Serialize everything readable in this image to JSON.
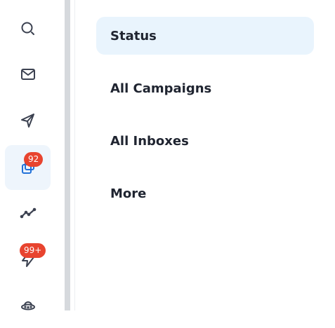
{
  "sidebar": {
    "items": [
      {
        "icon": "search-icon",
        "active": false
      },
      {
        "icon": "mail-icon",
        "active": false
      },
      {
        "icon": "send-icon",
        "active": false
      },
      {
        "icon": "copy-icon",
        "active": true,
        "badge": "92"
      },
      {
        "icon": "analytics-icon",
        "active": false
      },
      {
        "icon": "lightning-icon",
        "active": false,
        "badge": "99+"
      },
      {
        "icon": "ufo-icon",
        "active": false
      }
    ],
    "active_color": "#2272d9",
    "icon_color": "#3b4150",
    "badge_color": "#e8442f"
  },
  "menu": {
    "items": [
      {
        "label": "Status",
        "active": true
      },
      {
        "label": "All Campaigns",
        "active": false
      },
      {
        "label": "All Inboxes",
        "active": false
      },
      {
        "label": "More",
        "active": false
      }
    ]
  }
}
